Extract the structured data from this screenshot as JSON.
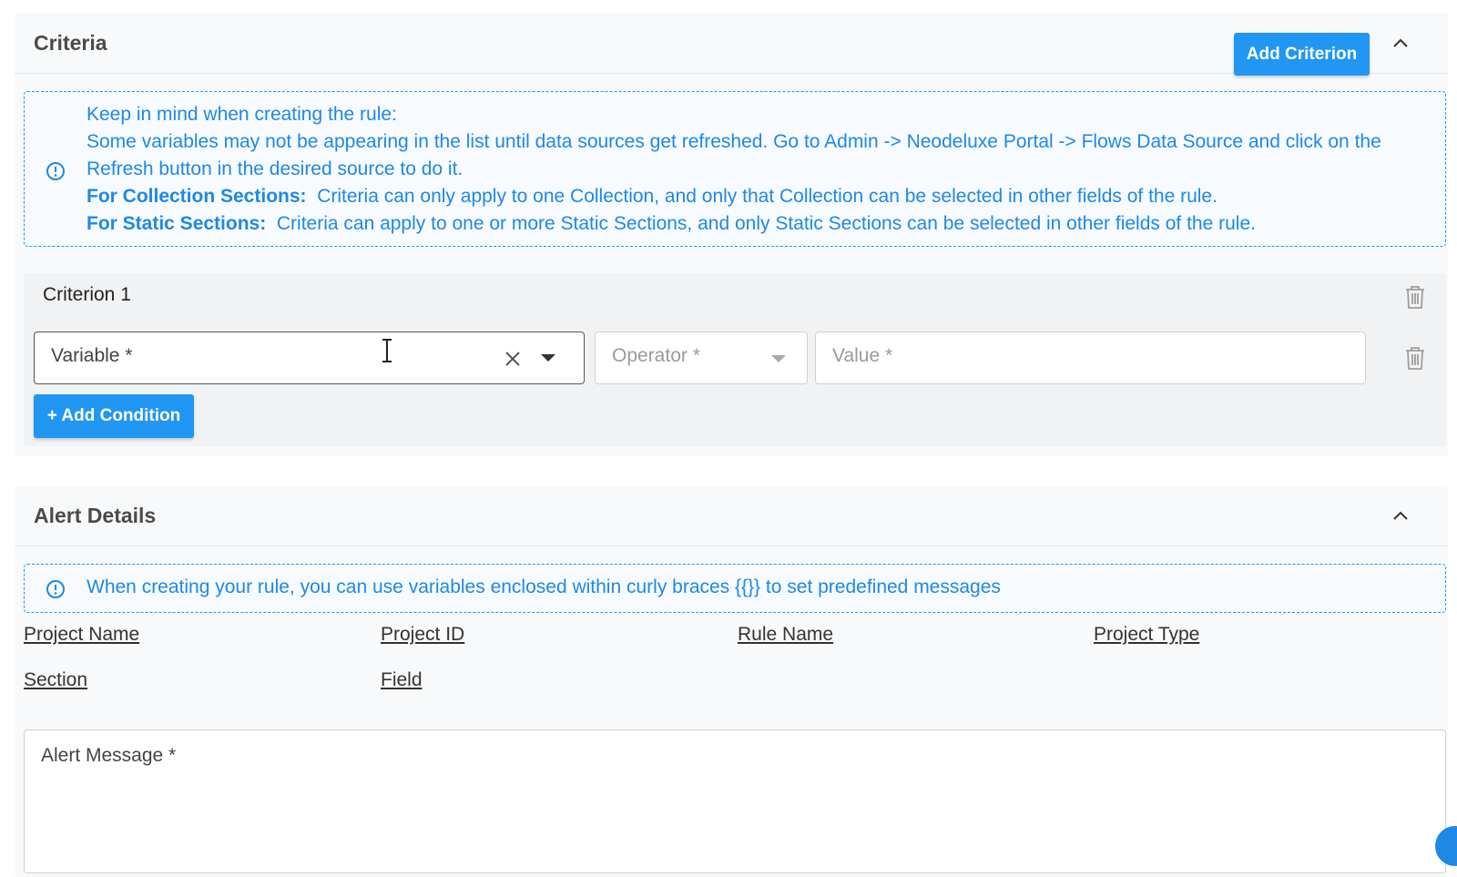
{
  "criteria": {
    "title": "Criteria",
    "add_button": "Add Criterion",
    "info": {
      "line1": "Keep in mind when creating the rule:",
      "line2": "Some variables may not be appearing in the list until data sources get refreshed. Go to Admin -> Neodeluxe Portal -> Flows Data Source and click on the Refresh button in the desired source to do it.",
      "line3_label": "For Collection Sections:",
      "line3_text": "Criteria can only apply to one Collection, and only that Collection can be selected in other fields of the rule.",
      "line4_label": "For Static Sections:",
      "line4_text": "Criteria can apply to one or more Static Sections, and only Static Sections can be selected in other fields of the rule."
    },
    "criterion": {
      "title": "Criterion 1",
      "variable_placeholder": "Variable *",
      "operator_placeholder": "Operator *",
      "value_placeholder": "Value *",
      "add_condition": "+ Add Condition"
    }
  },
  "alert": {
    "title": "Alert Details",
    "info": "When creating your rule, you can use variables enclosed within curly braces {{}} to set predefined messages",
    "variables": [
      "Project Name",
      "Project ID",
      "Rule Name",
      "Project Type",
      "Section",
      "Field"
    ],
    "message_placeholder": "Alert Message *"
  },
  "colors": {
    "accent": "#2196f3",
    "info_text": "#1e88e5"
  }
}
